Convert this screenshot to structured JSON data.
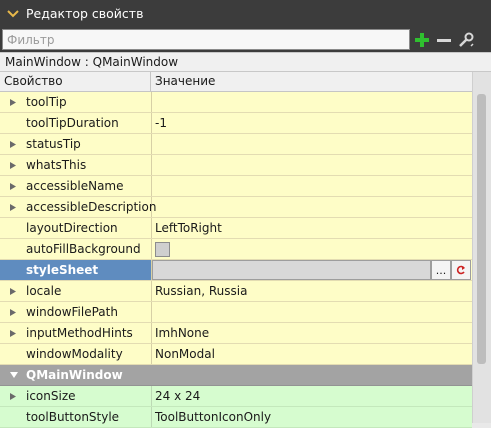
{
  "panel": {
    "title": "Редактор свойств"
  },
  "filter": {
    "placeholder": "Фильтр"
  },
  "object_label": "MainWindow : QMainWindow",
  "columns": {
    "property": "Свойство",
    "value": "Значение"
  },
  "rows": [
    {
      "name": "toolTip",
      "value": "",
      "expandable": true
    },
    {
      "name": "toolTipDuration",
      "value": "-1",
      "expandable": false
    },
    {
      "name": "statusTip",
      "value": "",
      "expandable": true
    },
    {
      "name": "whatsThis",
      "value": "",
      "expandable": true
    },
    {
      "name": "accessibleName",
      "value": "",
      "expandable": true
    },
    {
      "name": "accessibleDescription",
      "value": "",
      "expandable": true
    },
    {
      "name": "layoutDirection",
      "value": "LeftToRight",
      "expandable": false
    },
    {
      "name": "autoFillBackground",
      "value": "",
      "expandable": false,
      "checkbox": true,
      "checked": false
    },
    {
      "name": "styleSheet",
      "value": "",
      "expandable": false,
      "selected": true,
      "browse_label": "...",
      "reset_icon": "reset-arrow-icon"
    },
    {
      "name": "locale",
      "value": "Russian, Russia",
      "expandable": true
    },
    {
      "name": "windowFilePath",
      "value": "",
      "expandable": true
    },
    {
      "name": "inputMethodHints",
      "value": "ImhNone",
      "expandable": true
    },
    {
      "name": "windowModality",
      "value": "NonModal",
      "expandable": false
    }
  ],
  "section": {
    "name": "QMainWindow"
  },
  "section_rows": [
    {
      "name": "iconSize",
      "value": "24 x 24",
      "expandable": true
    },
    {
      "name": "toolButtonStyle",
      "value": "ToolButtonIconOnly",
      "expandable": false
    }
  ],
  "colors": {
    "title_bg": "#3c3c3c",
    "row_yellow": "#fefdc7",
    "row_green": "#d6fccf",
    "selected": "#5f8cbf",
    "section": "#a3a3a3",
    "add_green": "#2fbf2f"
  },
  "icons": [
    "chevron-down-icon",
    "add-icon",
    "remove-icon",
    "configure-wrench-icon",
    "expand-arrow-icon",
    "reset-arrow-icon"
  ]
}
